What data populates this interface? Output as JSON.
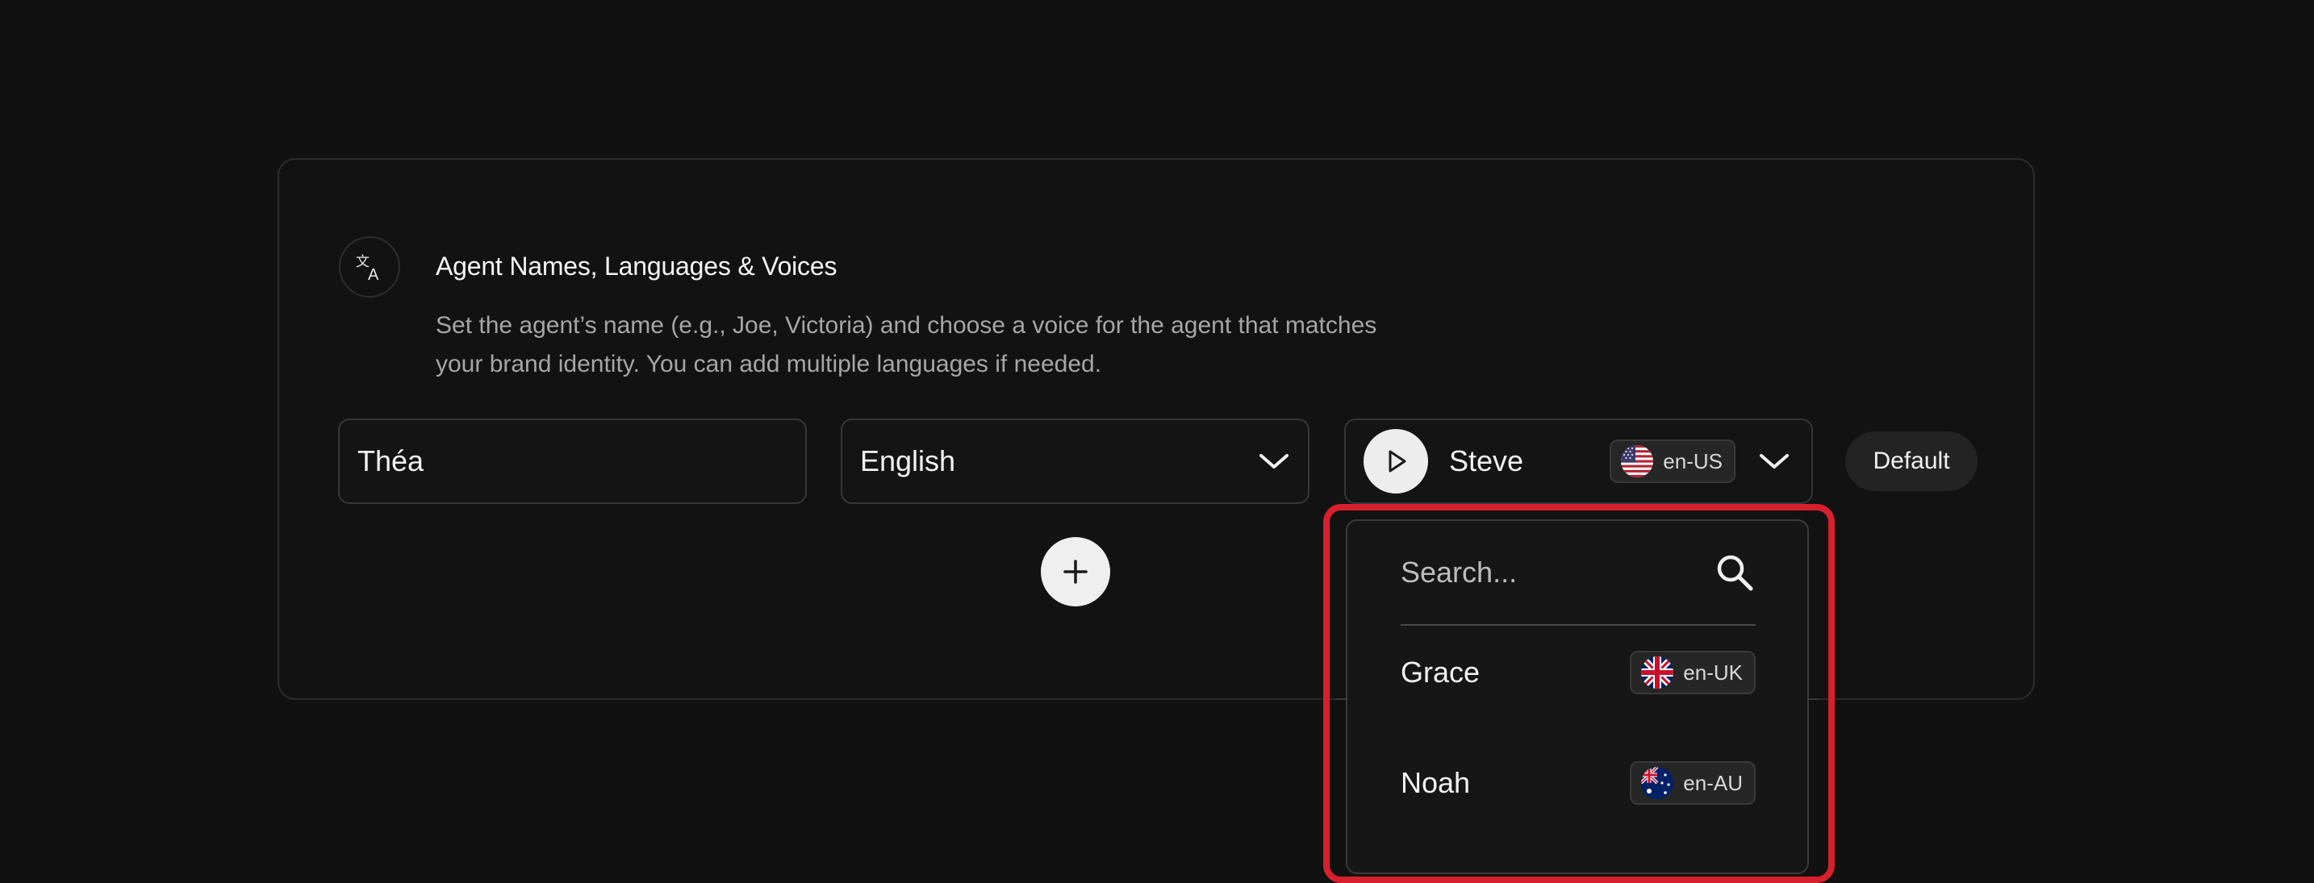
{
  "section": {
    "icon": "translate-icon",
    "title": "Agent Names, Languages & Voices",
    "description_line1": "Set the agent’s name (e.g., Joe, Victoria) and choose a voice for the agent that matches",
    "description_line2": "your brand identity. You can add multiple languages if needed."
  },
  "agent_name": {
    "value": "Théa"
  },
  "language": {
    "selected": "English"
  },
  "voice": {
    "name": "Steve",
    "locale": "en-US",
    "flag": "us-flag-icon"
  },
  "default_label": "Default",
  "voice_dropdown": {
    "search_placeholder": "Search...",
    "options": [
      {
        "name": "Grace",
        "locale": "en-UK",
        "flag": "uk-flag-icon"
      },
      {
        "name": "Noah",
        "locale": "en-AU",
        "flag": "au-flag-icon"
      }
    ]
  },
  "colors": {
    "background": "#111111",
    "highlight": "#d81f2c",
    "button_light": "#efefef"
  }
}
